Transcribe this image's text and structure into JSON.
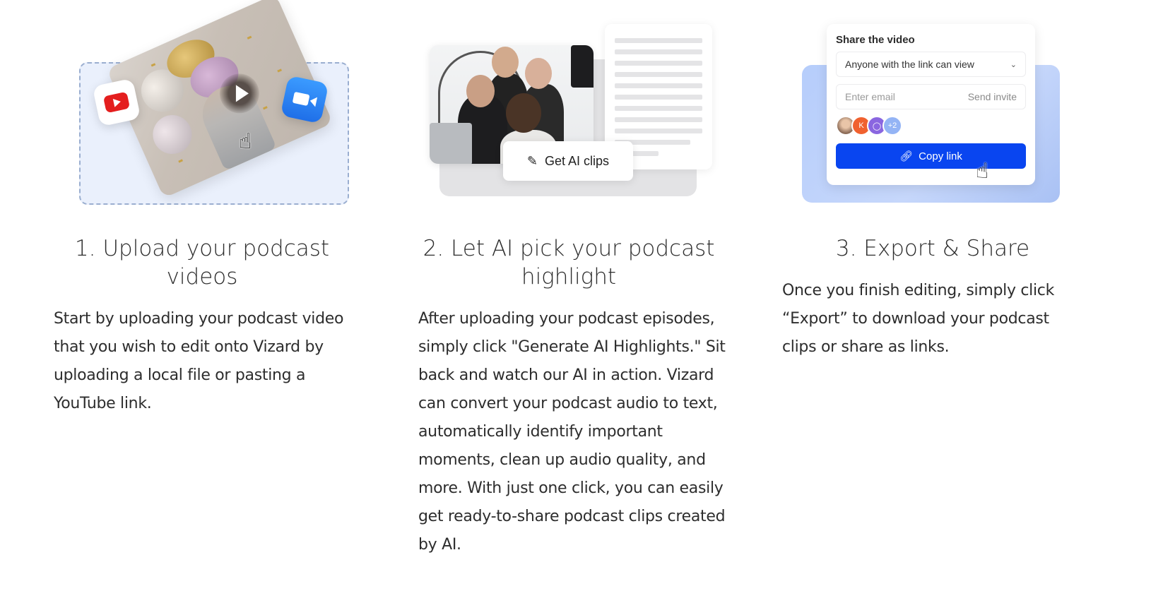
{
  "steps": [
    {
      "title": "1. Upload your podcast videos",
      "body": "Start by uploading your podcast video that you wish to edit onto Vizard by uploading a local file or pasting a YouTube link.",
      "illustration": {
        "icons": [
          "youtube-icon",
          "zoom-video-icon",
          "play-icon",
          "hand-cursor-icon"
        ]
      }
    },
    {
      "title": "2. Let AI pick your podcast highlight",
      "body": "After uploading your podcast episodes, simply click \"Generate AI Highlights.\" Sit back and watch our AI in action. Vizard can convert your podcast audio to text, automatically identify important moments, clean up audio quality, and more. With just one click, you can easily get ready-to-share podcast clips created by AI.",
      "illustration": {
        "button_label": "Get AI clips",
        "button_icon": "magic-wand-icon"
      }
    },
    {
      "title": "3. Export & Share",
      "body": "Once you finish editing, simply click “Export” to download your podcast clips or share as links.",
      "illustration": {
        "card_title": "Share the video",
        "permission_selected": "Anyone with the link can view",
        "email_placeholder": "Enter email",
        "send_invite_label": "Send invite",
        "avatars": [
          {
            "type": "photo",
            "label": ""
          },
          {
            "type": "initial",
            "label": "K",
            "color": "#f0612f"
          },
          {
            "type": "user-icon",
            "label": "",
            "color": "#8a66e0"
          },
          {
            "type": "more",
            "label": "+2",
            "color": "#94b4f5"
          }
        ],
        "copy_link_label": "Copy link",
        "copy_link_color": "#0945f0"
      }
    }
  ],
  "colors": {
    "text": "#2d2d2d",
    "dropzone_bg": "#eaf0fc",
    "dropzone_border": "#9aaed0",
    "youtube_red": "#e41e1e",
    "zoom_blue": "#2d86f5",
    "share_bg": "#b6cdfb"
  }
}
